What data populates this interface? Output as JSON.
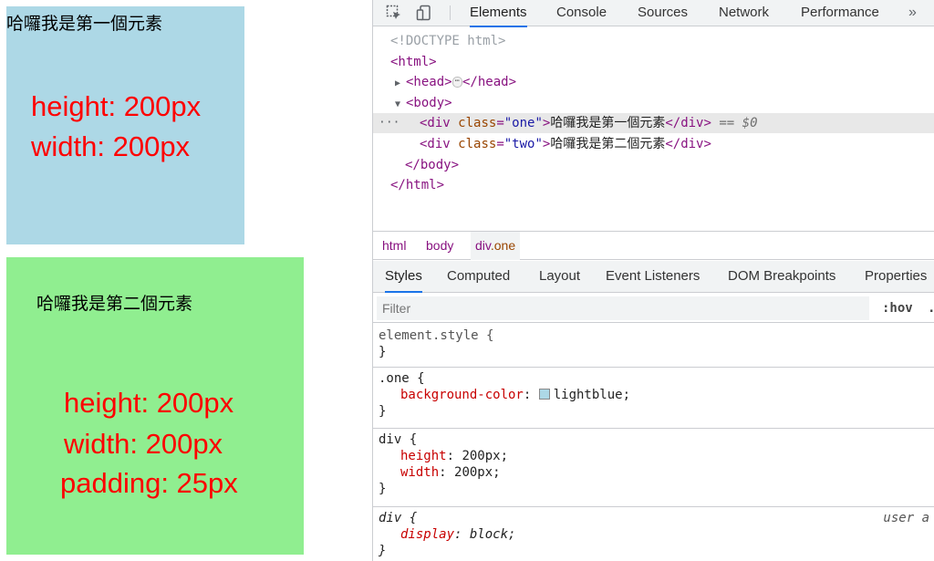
{
  "page": {
    "box_one": {
      "text": "哈囉我是第一個元素",
      "color": "#add8e6",
      "notes": [
        "height: 200px",
        "width: 200px"
      ]
    },
    "box_two": {
      "text": "哈囉我是第二個元素",
      "color": "#90ee90",
      "notes": [
        "height: 200px",
        "width: 200px",
        "padding: 25px"
      ]
    }
  },
  "devtools": {
    "tabs": [
      "Elements",
      "Console",
      "Sources",
      "Network",
      "Performance"
    ],
    "active_tab": "Elements",
    "overflow": "»",
    "dom": {
      "doctype": "<!DOCTYPE html>",
      "html_open": "<html>",
      "head_open": "<head>",
      "head_ellipsis": "⋯",
      "head_close": "</head>",
      "body_open": "<body>",
      "div_open": "<div",
      "div_close": "</div>",
      "class_attr": "class",
      "eq": "=",
      "gt": ">",
      "one_value": "\"one\"",
      "one_text": "哈囉我是第一個元素",
      "two_value": "\"two\"",
      "two_text": "哈囉我是第二個元素",
      "selected_ref": "== $0",
      "row_dots": "···",
      "body_close": "</body>",
      "html_close": "</html>"
    },
    "breadcrumbs": {
      "html": "html",
      "body": "body",
      "div": "div",
      "div_class": ".one"
    },
    "subtabs": [
      "Styles",
      "Computed",
      "Layout",
      "Event Listeners",
      "DOM Breakpoints",
      "Properties"
    ],
    "active_subtab": "Styles",
    "filter": {
      "placeholder": "Filter",
      "hov": ":hov",
      "more": "."
    },
    "styles": {
      "element_style": {
        "selector": "element.style {",
        "close": "}"
      },
      "one_rule": {
        "selector": ".one {",
        "prop": "background-color",
        "value": "lightblue;",
        "swatch": "#add8e6",
        "close": "}"
      },
      "div_rule": {
        "selector": "div {",
        "props": [
          {
            "name": "height",
            "value": "200px;"
          },
          {
            "name": "width",
            "value": "200px;"
          }
        ],
        "close": "}"
      },
      "ua_rule": {
        "selector": "div {",
        "origin": "user a",
        "prop": "display",
        "value": "block;",
        "close": "}"
      }
    }
  }
}
